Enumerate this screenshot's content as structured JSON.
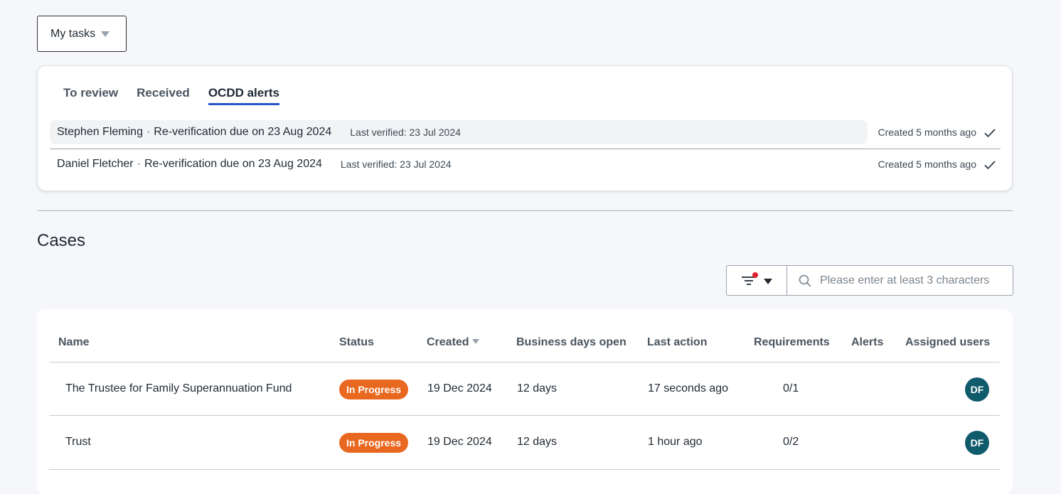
{
  "task_filter": {
    "label": "My tasks"
  },
  "tabs": [
    {
      "label": "To review",
      "active": false
    },
    {
      "label": "Received",
      "active": false
    },
    {
      "label": "OCDD alerts",
      "active": true
    }
  ],
  "alerts": [
    {
      "name": "Stephen Fleming",
      "message": "Re-verification due on 23 Aug 2024",
      "verified": "Last verified: 23 Jul 2024",
      "created": "Created 5 months ago"
    },
    {
      "name": "Daniel Fletcher",
      "message": "Re-verification due on 23 Aug 2024",
      "verified": "Last verified: 23 Jul 2024",
      "created": "Created 5 months ago"
    }
  ],
  "cases": {
    "title": "Cases",
    "search_placeholder": "Please enter at least 3 characters",
    "filter_active": true,
    "columns": {
      "name": "Name",
      "status": "Status",
      "created": "Created",
      "days": "Business days open",
      "last_action": "Last action",
      "requirements": "Requirements",
      "alerts": "Alerts",
      "users": "Assigned users"
    },
    "rows": [
      {
        "name": "The Trustee for Family Superannuation Fund",
        "status": "In Progress",
        "created": "19 Dec 2024",
        "days": "12 days",
        "last_action": "17 seconds ago",
        "requirements": "0/1",
        "alerts": "",
        "user": "DF"
      },
      {
        "name": "Trust",
        "status": "In Progress",
        "created": "19 Dec 2024",
        "days": "12 days",
        "last_action": "1 hour ago",
        "requirements": "0/2",
        "alerts": "",
        "user": "DF"
      }
    ]
  },
  "colors": {
    "accent": "#2754c5",
    "status_in_progress": "#e9681f",
    "avatar": "#0f5a6b",
    "filter_dot": "#e0202e"
  }
}
